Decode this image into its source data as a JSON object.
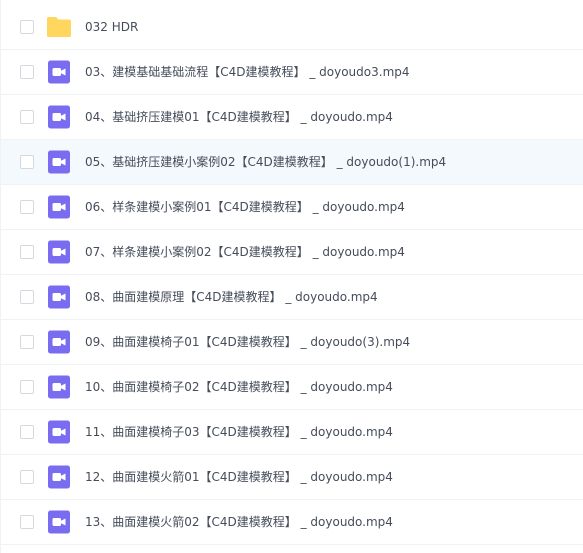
{
  "files": [
    {
      "name": "032 HDR",
      "icon": "folder-icon",
      "selected": false
    },
    {
      "name": "03、建模基础基础流程【C4D建模教程】 _ doyoudo3.mp4",
      "icon": "video-file-icon",
      "selected": false
    },
    {
      "name": "04、基础挤压建模01【C4D建模教程】 _ doyoudo.mp4",
      "icon": "video-file-icon",
      "selected": false
    },
    {
      "name": "05、基础挤压建模小案例02【C4D建模教程】 _ doyoudo(1).mp4",
      "icon": "video-file-icon",
      "selected": false
    },
    {
      "name": "06、样条建模小案例01【C4D建模教程】 _ doyoudo.mp4",
      "icon": "video-file-icon",
      "selected": false
    },
    {
      "name": "07、样条建模小案例02【C4D建模教程】 _ doyoudo.mp4",
      "icon": "video-file-icon",
      "selected": false
    },
    {
      "name": "08、曲面建模原理【C4D建模教程】 _ doyoudo.mp4",
      "icon": "video-file-icon",
      "selected": false
    },
    {
      "name": "09、曲面建模椅子01【C4D建模教程】 _ doyoudo(3).mp4",
      "icon": "video-file-icon",
      "selected": false
    },
    {
      "name": "10、曲面建模椅子02【C4D建模教程】 _ doyoudo.mp4",
      "icon": "video-file-icon",
      "selected": false
    },
    {
      "name": "11、曲面建模椅子03【C4D建模教程】 _ doyoudo.mp4",
      "icon": "video-file-icon",
      "selected": false
    },
    {
      "name": "12、曲面建模火箭01【C4D建模教程】 _ doyoudo.mp4",
      "icon": "video-file-icon",
      "selected": false
    },
    {
      "name": "13、曲面建模火箭02【C4D建模教程】 _ doyoudo.mp4",
      "icon": "video-file-icon",
      "selected": false
    }
  ],
  "hovered_row": 3,
  "colors": {
    "folder": "#ffd75e",
    "video_icon": "#7a6cf0",
    "hover_background": "#f4f9fe",
    "text": "#454d5a"
  }
}
